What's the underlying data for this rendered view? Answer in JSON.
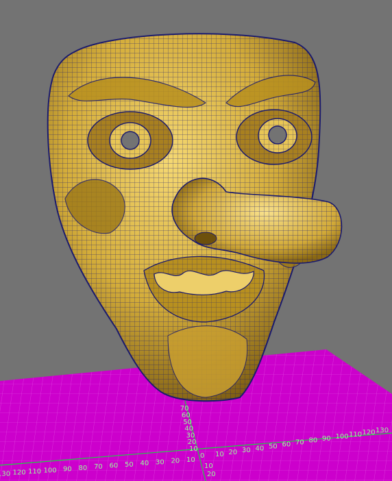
{
  "viewport": {
    "background": "#737373",
    "model": {
      "fill": "#d9b440",
      "fill_light": "#f2d46a",
      "fill_dark": "#8c6a12",
      "wireframe": "#1a1a6e"
    },
    "grid": {
      "color": "#cc00cc",
      "line_color": "#e455e4",
      "label_color": "#9aff9a",
      "axis_color": "#20d040"
    }
  },
  "grid_labels": {
    "x_positive": [
      "10",
      "20",
      "30",
      "40",
      "50",
      "60",
      "70",
      "80",
      "90",
      "100",
      "110",
      "120",
      "130"
    ],
    "x_negative": [
      "10",
      "20",
      "30",
      "40",
      "50",
      "60",
      "70",
      "80",
      "90",
      "100",
      "110",
      "120",
      "130"
    ],
    "x_origin": "0",
    "z_negative": [
      "10",
      "20",
      "30",
      "40",
      "50",
      "60",
      "70"
    ],
    "z_positive": [
      "10",
      "20"
    ]
  }
}
